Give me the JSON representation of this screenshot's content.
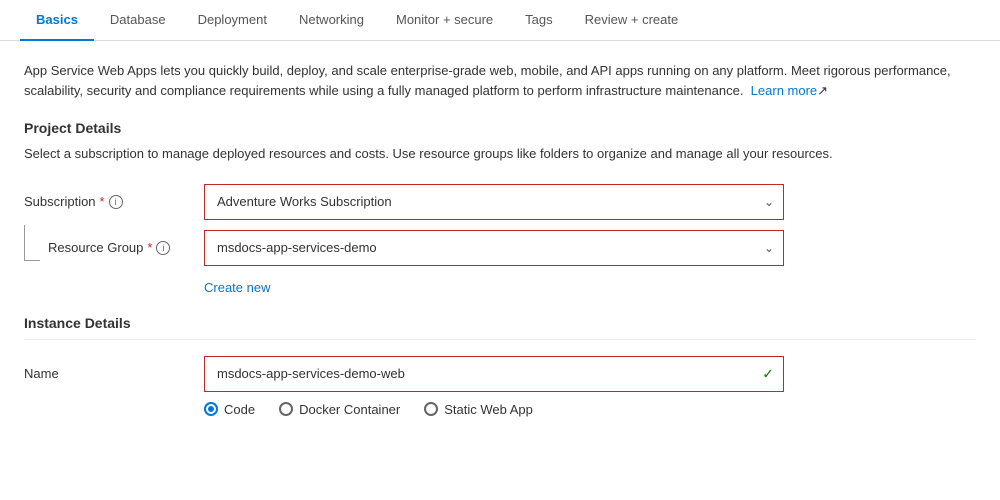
{
  "tabs": [
    {
      "id": "basics",
      "label": "Basics",
      "active": true
    },
    {
      "id": "database",
      "label": "Database",
      "active": false
    },
    {
      "id": "deployment",
      "label": "Deployment",
      "active": false
    },
    {
      "id": "networking",
      "label": "Networking",
      "active": false
    },
    {
      "id": "monitor",
      "label": "Monitor + secure",
      "active": false
    },
    {
      "id": "tags",
      "label": "Tags",
      "active": false
    },
    {
      "id": "review",
      "label": "Review + create",
      "active": false
    }
  ],
  "description": "App Service Web Apps lets you quickly build, deploy, and scale enterprise-grade web, mobile, and API apps running on any platform. Meet rigorous performance, scalability, security and compliance requirements while using a fully managed platform to perform infrastructure maintenance.",
  "learn_more_label": "Learn more",
  "project_details": {
    "title": "Project Details",
    "description": "Select a subscription to manage deployed resources and costs. Use resource groups like folders to organize and manage all your resources."
  },
  "subscription_field": {
    "label": "Subscription",
    "required": true,
    "value": "Adventure Works Subscription",
    "options": [
      "Adventure Works Subscription"
    ]
  },
  "resource_group_field": {
    "label": "Resource Group",
    "required": true,
    "value": "msdocs-app-services-demo",
    "options": [
      "msdocs-app-services-demo"
    ]
  },
  "create_new_label": "Create new",
  "instance_details": {
    "title": "Instance Details"
  },
  "name_field": {
    "label": "Name",
    "value": "msdocs-app-services-demo-web"
  },
  "publish_options": [
    {
      "label": "Code",
      "selected": true
    },
    {
      "label": "Docker Container",
      "selected": false
    },
    {
      "label": "Static Web App",
      "selected": false
    }
  ],
  "colors": {
    "accent": "#0078d4",
    "required": "#c4262e",
    "border_highlight": "#c4262e",
    "success": "#107c10"
  }
}
